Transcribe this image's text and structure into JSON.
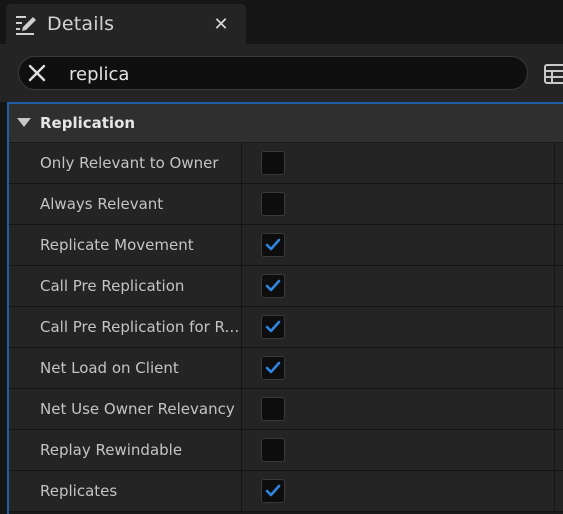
{
  "tab": {
    "title": "Details",
    "icon": "details-pencil-icon",
    "close_icon": "close-icon"
  },
  "search": {
    "value": "replica",
    "clear_icon": "clear-search-icon",
    "view_options_icon": "table-view-icon"
  },
  "category": {
    "label": "Replication",
    "expanded": true
  },
  "properties": [
    {
      "label": "Only Relevant to Owner",
      "checked": false
    },
    {
      "label": "Always Relevant",
      "checked": false
    },
    {
      "label": "Replicate Movement",
      "checked": true
    },
    {
      "label": "Call Pre Replication",
      "checked": true
    },
    {
      "label": "Call Pre Replication for Re...",
      "checked": true
    },
    {
      "label": "Net Load on Client",
      "checked": true
    },
    {
      "label": "Net Use Owner Relevancy",
      "checked": false
    },
    {
      "label": "Replay Rewindable",
      "checked": false
    },
    {
      "label": "Replicates",
      "checked": true
    }
  ],
  "colors": {
    "accent": "#1e5fa8",
    "check": "#2f86e0",
    "panel_bg": "#242424",
    "category_bg": "#2f2f2f"
  }
}
